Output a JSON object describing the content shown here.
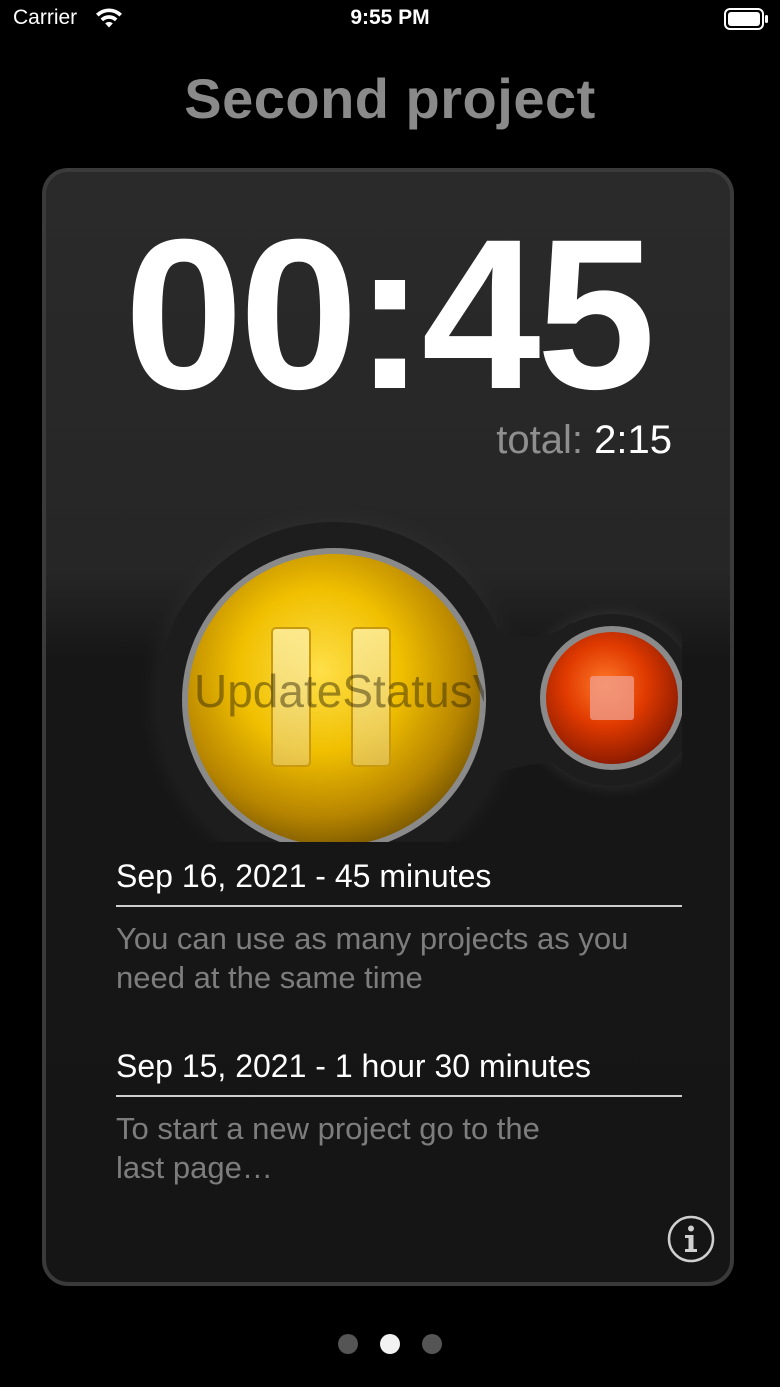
{
  "status_bar": {
    "carrier": "Carrier",
    "time": "9:55 PM",
    "icons": [
      "wifi-icon",
      "battery-icon"
    ]
  },
  "project": {
    "title": "Second project",
    "timer": "00:45",
    "total_label": "total:",
    "total_value": "2:15"
  },
  "controls": {
    "pause_icon": "pause-icon",
    "stop_icon": "stop-icon",
    "watermark": "UpdateStatusView",
    "colors": {
      "pause": "#e8b800",
      "stop": "#d83000"
    }
  },
  "history": [
    {
      "title": "Sep 16, 2021 - 45 minutes",
      "note": "You can use as many projects as you need at the same time"
    },
    {
      "title": "Sep 15, 2021 - 1 hour 30 minutes",
      "note": "To start a new project go to the last page…"
    }
  ],
  "info_icon": "info-icon",
  "pager": {
    "pages": 3,
    "current": 2
  }
}
